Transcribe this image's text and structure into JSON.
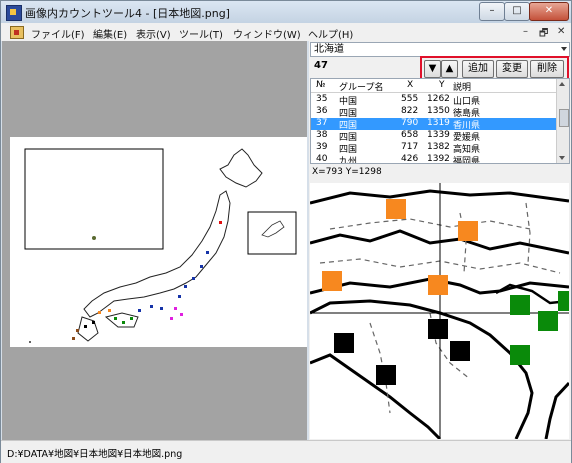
{
  "window": {
    "title": "画像内カウントツール4 - [日本地図.png]"
  },
  "menu": {
    "items": [
      "ファイル(F)",
      "編集(E)",
      "表示(V)",
      "ツール(T)",
      "ウィンドウ(W)",
      "ヘルプ(H)"
    ],
    "mdi_controls": [
      "–",
      "🗗",
      "✕"
    ]
  },
  "window_controls": {
    "minimize": "–",
    "maximize": "□",
    "close": "✕"
  },
  "panel": {
    "group_select": "北海道",
    "count": "47",
    "buttons": {
      "down": "▼",
      "up": "▲",
      "add": "追加",
      "change": "変更",
      "delete": "削除"
    },
    "list": {
      "columns": [
        "№",
        "グループ名",
        "X",
        "Y",
        "説明"
      ],
      "rows": [
        [
          "35",
          "中国",
          "555",
          "1262",
          "山口県"
        ],
        [
          "36",
          "四国",
          "822",
          "1350",
          "徳島県"
        ],
        [
          "37",
          "四国",
          "790",
          "1319",
          "香川県"
        ],
        [
          "38",
          "四国",
          "658",
          "1339",
          "愛媛県"
        ],
        [
          "39",
          "四国",
          "717",
          "1382",
          "高知県"
        ],
        [
          "40",
          "九州",
          "426",
          "1392",
          "福岡県"
        ]
      ],
      "selected_index": 2
    },
    "cursor_readout": "X=793 Y=1298"
  },
  "status": {
    "path": "D:¥DATA¥地図¥日本地図¥日本地図.png"
  },
  "colors": {
    "selection": "#3399ff",
    "highlight_box": "#e0102a",
    "orange": "#f7881f",
    "green": "#0a8a0a",
    "black": "#000000"
  },
  "icons": [
    "app-icon",
    "document-icon",
    "arrow-down-icon",
    "arrow-up-icon",
    "dropdown-arrow-icon"
  ]
}
